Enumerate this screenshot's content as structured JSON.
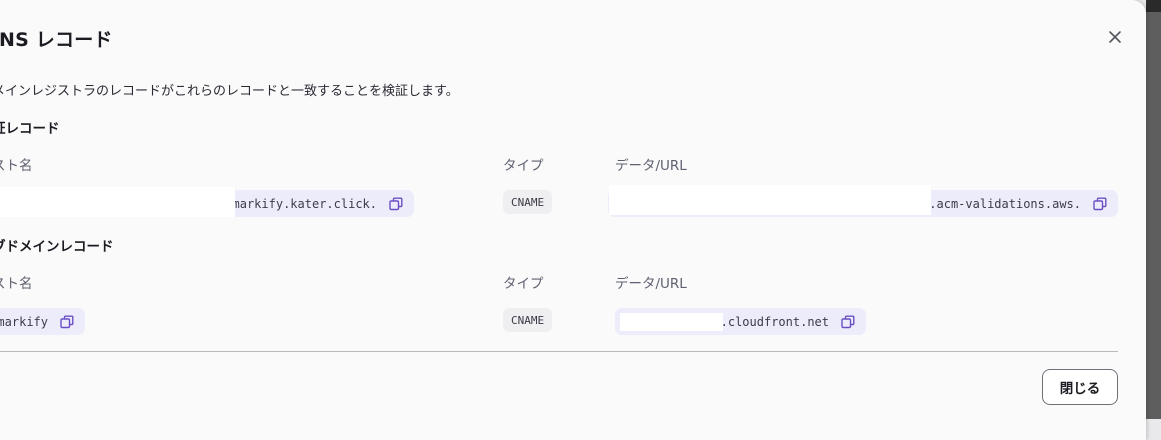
{
  "dialog": {
    "title": "NS レコード",
    "description": "メインレジストラのレコードがこれらのレコードと一致することを検証します。",
    "close_label": "閉じる"
  },
  "verification_records": {
    "section_title": "証レコード",
    "headers": {
      "host": "スト名",
      "type": "タイプ",
      "data": "データ/URL"
    },
    "row": {
      "host": "markify.kater.click.",
      "type": "CNAME",
      "data": ".acm-validations.aws."
    }
  },
  "subdomain_records": {
    "section_title": "ブドメインレコード",
    "headers": {
      "host": "スト名",
      "type": "タイプ",
      "data": "データ/URL"
    },
    "row": {
      "host": "markify",
      "type": "CNAME",
      "data": ".cloudfront.net"
    }
  },
  "colors": {
    "accent_chip": "#ececfa",
    "icon": "#6b4fc4"
  }
}
